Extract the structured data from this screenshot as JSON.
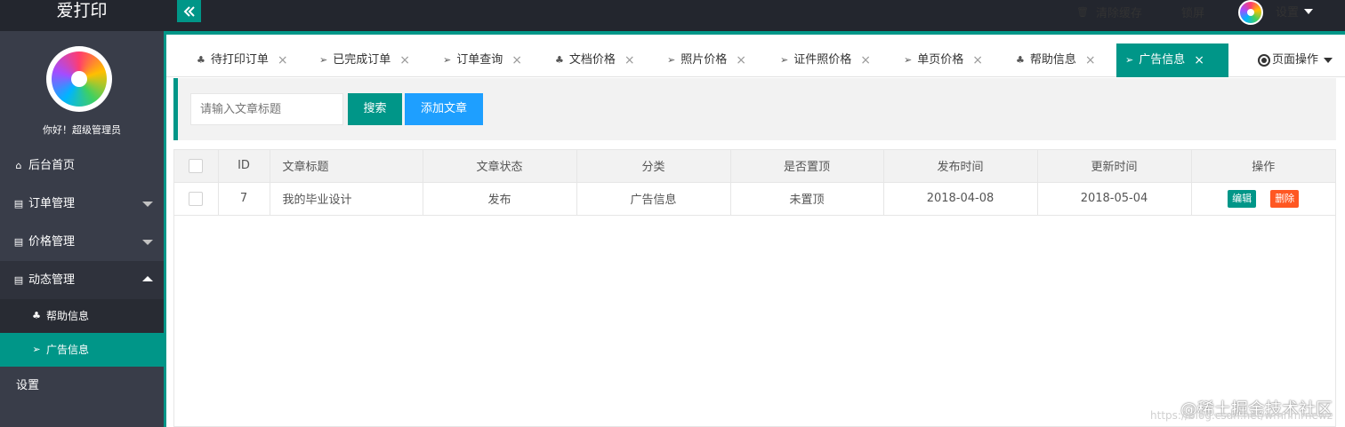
{
  "app": {
    "title": "爱打印"
  },
  "header": {
    "clear_cache": "清除缓存",
    "lock_screen": "锁屏",
    "settings": "设置"
  },
  "sidebar": {
    "greeting": "你好！超级管理员",
    "items": [
      {
        "label": "后台首页"
      },
      {
        "label": "订单管理"
      },
      {
        "label": "价格管理"
      },
      {
        "label": "动态管理"
      }
    ],
    "sub_items": [
      {
        "label": "帮助信息"
      },
      {
        "label": "广告信息"
      }
    ],
    "settings": "设置"
  },
  "tabs": [
    {
      "label": "待打印订单"
    },
    {
      "label": "已完成订单"
    },
    {
      "label": "订单查询"
    },
    {
      "label": "文档价格"
    },
    {
      "label": "照片价格"
    },
    {
      "label": "证件照价格"
    },
    {
      "label": "单页价格"
    },
    {
      "label": "帮助信息"
    },
    {
      "label": "广告信息"
    }
  ],
  "active_tab": "广告信息",
  "page_ops": "页面操作",
  "search": {
    "placeholder": "请输入文章标题",
    "search_label": "搜索",
    "add_label": "添加文章"
  },
  "table": {
    "columns": [
      "ID",
      "文章标题",
      "文章状态",
      "分类",
      "是否置顶",
      "发布时间",
      "更新时间",
      "操作"
    ],
    "rows": [
      {
        "id": "7",
        "title": "我的毕业设计",
        "status": "发布",
        "category": "广告信息",
        "pinned": "未置顶",
        "published": "2018-04-08",
        "updated": "2018-05-04"
      }
    ],
    "edit_label": "编辑",
    "delete_label": "删除"
  },
  "watermark": {
    "text": "@稀土掘金技术社区",
    "url": "https://blog.csdn.net/wmhmrnewz"
  },
  "colors": {
    "accent": "#009688",
    "blue": "#1e9fff",
    "danger": "#ff5722",
    "sidebar": "#393d49",
    "topbar": "#23262e"
  }
}
